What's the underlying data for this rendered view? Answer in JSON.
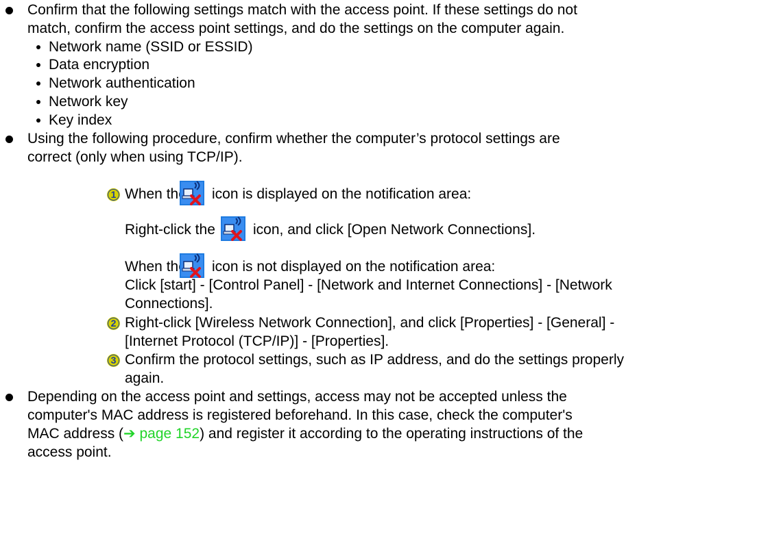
{
  "bullet1": {
    "line1": "Confirm that the following settings match with the access point.  If these settings do not",
    "line2": "match, confirm the access point settings, and do the settings on the computer again.",
    "items": [
      "Network name (SSID or ESSID)",
      "Data encryption",
      "Network authentication",
      "Network key",
      "Key index"
    ]
  },
  "bullet2": {
    "line1": "Using the following procedure, confirm whether the computer’s protocol settings are",
    "line2": "correct (only when using TCP/IP)."
  },
  "steps": {
    "s1": {
      "num": "1"
    },
    "s2": {
      "num": "2"
    },
    "s3": {
      "num": "3"
    }
  },
  "texts": {
    "s1_a_pre": "When the",
    "s1_a_post": "icon is displayed on the notification area:",
    "s1_b_pre": "Right-click the",
    "s1_b_post": "icon, and click [Open Network Connections].",
    "s1_c_pre": "When the",
    "s1_c_post": "icon is not displayed on the notification area:",
    "s1_d1": "Click [start] - [Control Panel] - [Network and Internet Connections] - [Network",
    "s1_d2": "Connections].",
    "s2_1": "Right-click [Wireless Network Connection], and click [Properties] - [General] -",
    "s2_2": "[Internet Protocol (TCP/IP)] - [Properties].",
    "s3_1": "Confirm the protocol settings, such as IP address, and do the settings properly",
    "s3_2": "again."
  },
  "bullet3": {
    "line1": "Depending on the access point and settings, access may not be accepted unless the",
    "line2": "computer's MAC address is registered beforehand.   In this case, check the computer's",
    "line3_pre": "MAC address (",
    "arrow": "➔",
    "link_text": "page 152",
    "line3_post": ") and register it according to the operating instructions of the",
    "line4": "access point."
  },
  "icons": {
    "wireless": "wireless-disconnected-icon",
    "accent_blue": "#2a6fd6",
    "accent_red": "#e0141e",
    "link_color": "#22d42a"
  }
}
